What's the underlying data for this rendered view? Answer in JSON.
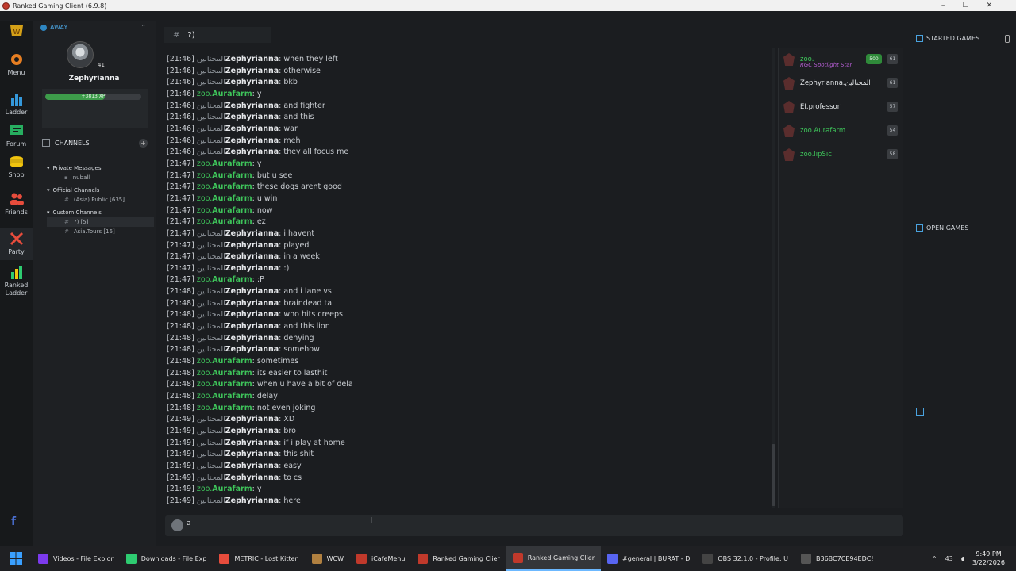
{
  "window": {
    "title": "Ranked Gaming Client (6.9.8)",
    "controls": [
      "–",
      "☐",
      "✕"
    ]
  },
  "rail": [
    {
      "label": "Menu",
      "icon": "gear-icon",
      "color": "#e67e22"
    },
    {
      "label": "Ladder",
      "icon": "bar-chart-icon",
      "color": "#3498db"
    },
    {
      "label": "Forum",
      "icon": "forum-icon",
      "color": "#27ae60"
    },
    {
      "label": "Shop",
      "icon": "coins-icon",
      "color": "#f1c40f"
    },
    {
      "label": "Friends",
      "icon": "friends-icon",
      "color": "#e74c3c"
    },
    {
      "label": "Party",
      "icon": "swords-icon",
      "color": "#e74c3c"
    },
    {
      "label": "Ranked Ladder",
      "icon": "ranked-ladder-icon",
      "color": "#2ecc71"
    }
  ],
  "profile": {
    "status": "AWAY",
    "level": "41",
    "name": "Zephyrianna",
    "xp_text": "+3813 XP",
    "xp_progress": 0.62
  },
  "channels": {
    "header": "CHANNELS",
    "groups": [
      {
        "label": "Private Messages",
        "items": [
          "nuball"
        ]
      },
      {
        "label": "Official Channels",
        "items": [
          "(Asia) Public [635]"
        ]
      },
      {
        "label": "Custom Channels",
        "items": [
          "?) [5]",
          "Asia.Tours [16]"
        ]
      }
    ]
  },
  "chat": {
    "channel_name": "?)",
    "messages": [
      {
        "time": "[21:46]",
        "prefix": "المحتالين",
        "nick": "Zephyrianna",
        "text": "when they left"
      },
      {
        "time": "[21:46]",
        "prefix": "المحتالين",
        "nick": "Zephyrianna",
        "text": "otherwise"
      },
      {
        "time": "[21:46]",
        "prefix": "المحتالين",
        "nick": "Zephyrianna",
        "text": "bkb"
      },
      {
        "time": "[21:46]",
        "prefix": "zoo.",
        "nick": "Aurafarm",
        "text": "y"
      },
      {
        "time": "[21:46]",
        "prefix": "المحتالين",
        "nick": "Zephyrianna",
        "text": "and fighter"
      },
      {
        "time": "[21:46]",
        "prefix": "المحتالين",
        "nick": "Zephyrianna",
        "text": "and this"
      },
      {
        "time": "[21:46]",
        "prefix": "المحتالين",
        "nick": "Zephyrianna",
        "text": "war"
      },
      {
        "time": "[21:46]",
        "prefix": "المحتالين",
        "nick": "Zephyrianna",
        "text": "meh"
      },
      {
        "time": "[21:46]",
        "prefix": "المحتالين",
        "nick": "Zephyrianna",
        "text": "they all focus me"
      },
      {
        "time": "[21:47]",
        "prefix": "zoo.",
        "nick": "Aurafarm",
        "text": "y"
      },
      {
        "time": "[21:47]",
        "prefix": "zoo.",
        "nick": "Aurafarm",
        "text": "but u see"
      },
      {
        "time": "[21:47]",
        "prefix": "zoo.",
        "nick": "Aurafarm",
        "text": "these dogs arent good"
      },
      {
        "time": "[21:47]",
        "prefix": "zoo.",
        "nick": "Aurafarm",
        "text": "u win"
      },
      {
        "time": "[21:47]",
        "prefix": "zoo.",
        "nick": "Aurafarm",
        "text": "now"
      },
      {
        "time": "[21:47]",
        "prefix": "zoo.",
        "nick": "Aurafarm",
        "text": "ez"
      },
      {
        "time": "[21:47]",
        "prefix": "المحتالين",
        "nick": "Zephyrianna",
        "text": "i havent"
      },
      {
        "time": "[21:47]",
        "prefix": "المحتالين",
        "nick": "Zephyrianna",
        "text": "played"
      },
      {
        "time": "[21:47]",
        "prefix": "المحتالين",
        "nick": "Zephyrianna",
        "text": "in a week"
      },
      {
        "time": "[21:47]",
        "prefix": "المحتالين",
        "nick": "Zephyrianna",
        "text": ":)"
      },
      {
        "time": "[21:47]",
        "prefix": "zoo.",
        "nick": "Aurafarm",
        "text": ":P"
      },
      {
        "time": "[21:48]",
        "prefix": "المحتالين",
        "nick": "Zephyrianna",
        "text": "and i lane vs"
      },
      {
        "time": "[21:48]",
        "prefix": "المحتالين",
        "nick": "Zephyrianna",
        "text": "braindead ta"
      },
      {
        "time": "[21:48]",
        "prefix": "المحتالين",
        "nick": "Zephyrianna",
        "text": "who hits creeps"
      },
      {
        "time": "[21:48]",
        "prefix": "المحتالين",
        "nick": "Zephyrianna",
        "text": "and this lion"
      },
      {
        "time": "[21:48]",
        "prefix": "المحتالين",
        "nick": "Zephyrianna",
        "text": "denying"
      },
      {
        "time": "[21:48]",
        "prefix": "المحتالين",
        "nick": "Zephyrianna",
        "text": "somehow"
      },
      {
        "time": "[21:48]",
        "prefix": "zoo.",
        "nick": "Aurafarm",
        "text": "sometimes"
      },
      {
        "time": "[21:48]",
        "prefix": "zoo.",
        "nick": "Aurafarm",
        "text": "its easier to lasthit"
      },
      {
        "time": "[21:48]",
        "prefix": "zoo.",
        "nick": "Aurafarm",
        "text": "when u have a bit of dela"
      },
      {
        "time": "[21:48]",
        "prefix": "zoo.",
        "nick": "Aurafarm",
        "text": "delay"
      },
      {
        "time": "[21:48]",
        "prefix": "zoo.",
        "nick": "Aurafarm",
        "text": "not even joking"
      },
      {
        "time": "[21:49]",
        "prefix": "المحتالين",
        "nick": "Zephyrianna",
        "text": "XD"
      },
      {
        "time": "[21:49]",
        "prefix": "المحتالين",
        "nick": "Zephyrianna",
        "text": "bro"
      },
      {
        "time": "[21:49]",
        "prefix": "المحتالين",
        "nick": "Zephyrianna",
        "text": "if i play at home"
      },
      {
        "time": "[21:49]",
        "prefix": "المحتالين",
        "nick": "Zephyrianna",
        "text": "this shit"
      },
      {
        "time": "[21:49]",
        "prefix": "المحتالين",
        "nick": "Zephyrianna",
        "text": "easy"
      },
      {
        "time": "[21:49]",
        "prefix": "المحتالين",
        "nick": "Zephyrianna",
        "text": "to cs"
      },
      {
        "time": "[21:49]",
        "prefix": "zoo.",
        "nick": "Aurafarm",
        "text": "y"
      },
      {
        "time": "[21:49]",
        "prefix": "المحتالين",
        "nick": "Zephyrianna",
        "text": "here"
      }
    ],
    "input_value": "a"
  },
  "users": [
    {
      "prefix": "zoo.",
      "name": "",
      "sub": "RGC Spotlight Star",
      "rank": "500",
      "badge": "61"
    },
    {
      "prefix": "",
      "name": "Zephyrianna.المحتالين",
      "sub": "",
      "rank": "",
      "badge": "61"
    },
    {
      "prefix": "",
      "name": "EI.professor",
      "sub": "",
      "rank": "",
      "badge": "57"
    },
    {
      "prefix": "zoo.",
      "name": "Aurafarm",
      "sub": "",
      "rank": "",
      "badge": "54"
    },
    {
      "prefix": "zoo.",
      "name": "lipSic",
      "sub": "",
      "rank": "",
      "badge": "58"
    }
  ],
  "right_panel": {
    "started_games": "STARTED GAMES",
    "open_games": "OPEN GAMES"
  },
  "taskbar": {
    "items": [
      {
        "label": "Videos - File Explor",
        "icon": "video-folder-icon",
        "color": "#7c3aed"
      },
      {
        "label": "Downloads - File Exp",
        "icon": "download-icon",
        "color": "#2ecc71"
      },
      {
        "label": "METRIC - Lost Kitten",
        "icon": "chrome-icon",
        "color": "#e74c3c"
      },
      {
        "label": "WCW",
        "icon": "wc3-icon",
        "color": "#b08040"
      },
      {
        "label": "iCafeMenu",
        "icon": "icafe-icon",
        "color": "#c0392b"
      },
      {
        "label": "Ranked Gaming Clier",
        "icon": "rgc-icon",
        "color": "#c0392b"
      },
      {
        "label": "Ranked Gaming Clier",
        "icon": "rgc-icon",
        "color": "#c0392b",
        "active": true
      },
      {
        "label": "#general | BURAT - D",
        "icon": "discord-icon",
        "color": "#5865f2"
      },
      {
        "label": "OBS 32.1.0 - Profile: U",
        "icon": "obs-icon",
        "color": "#444"
      },
      {
        "label": "B36BC7CE94EDC!",
        "icon": "app-icon",
        "color": "#555"
      }
    ],
    "tray_text": "43",
    "time": "9:49 PM",
    "date": "3/22/2026"
  }
}
